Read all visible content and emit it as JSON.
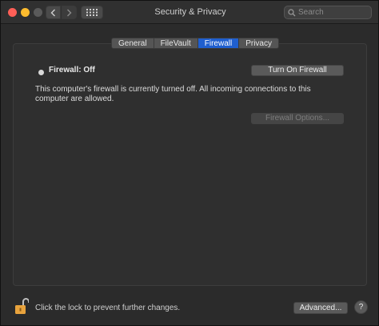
{
  "window": {
    "title": "Security & Privacy"
  },
  "search": {
    "placeholder": "Search"
  },
  "tabs": [
    {
      "label": "General",
      "active": false
    },
    {
      "label": "FileVault",
      "active": false
    },
    {
      "label": "Firewall",
      "active": true
    },
    {
      "label": "Privacy",
      "active": false
    }
  ],
  "firewall": {
    "status_label": "Firewall: Off",
    "turn_on_label": "Turn On Firewall",
    "description": "This computer's firewall is currently turned off. All incoming connections to this computer are allowed.",
    "options_label": "Firewall Options..."
  },
  "footer": {
    "lock_text": "Click the lock to prevent further changes.",
    "advanced_label": "Advanced...",
    "help_label": "?"
  },
  "colors": {
    "accent": "#1f5fcf",
    "lock": "#e8a33d"
  }
}
